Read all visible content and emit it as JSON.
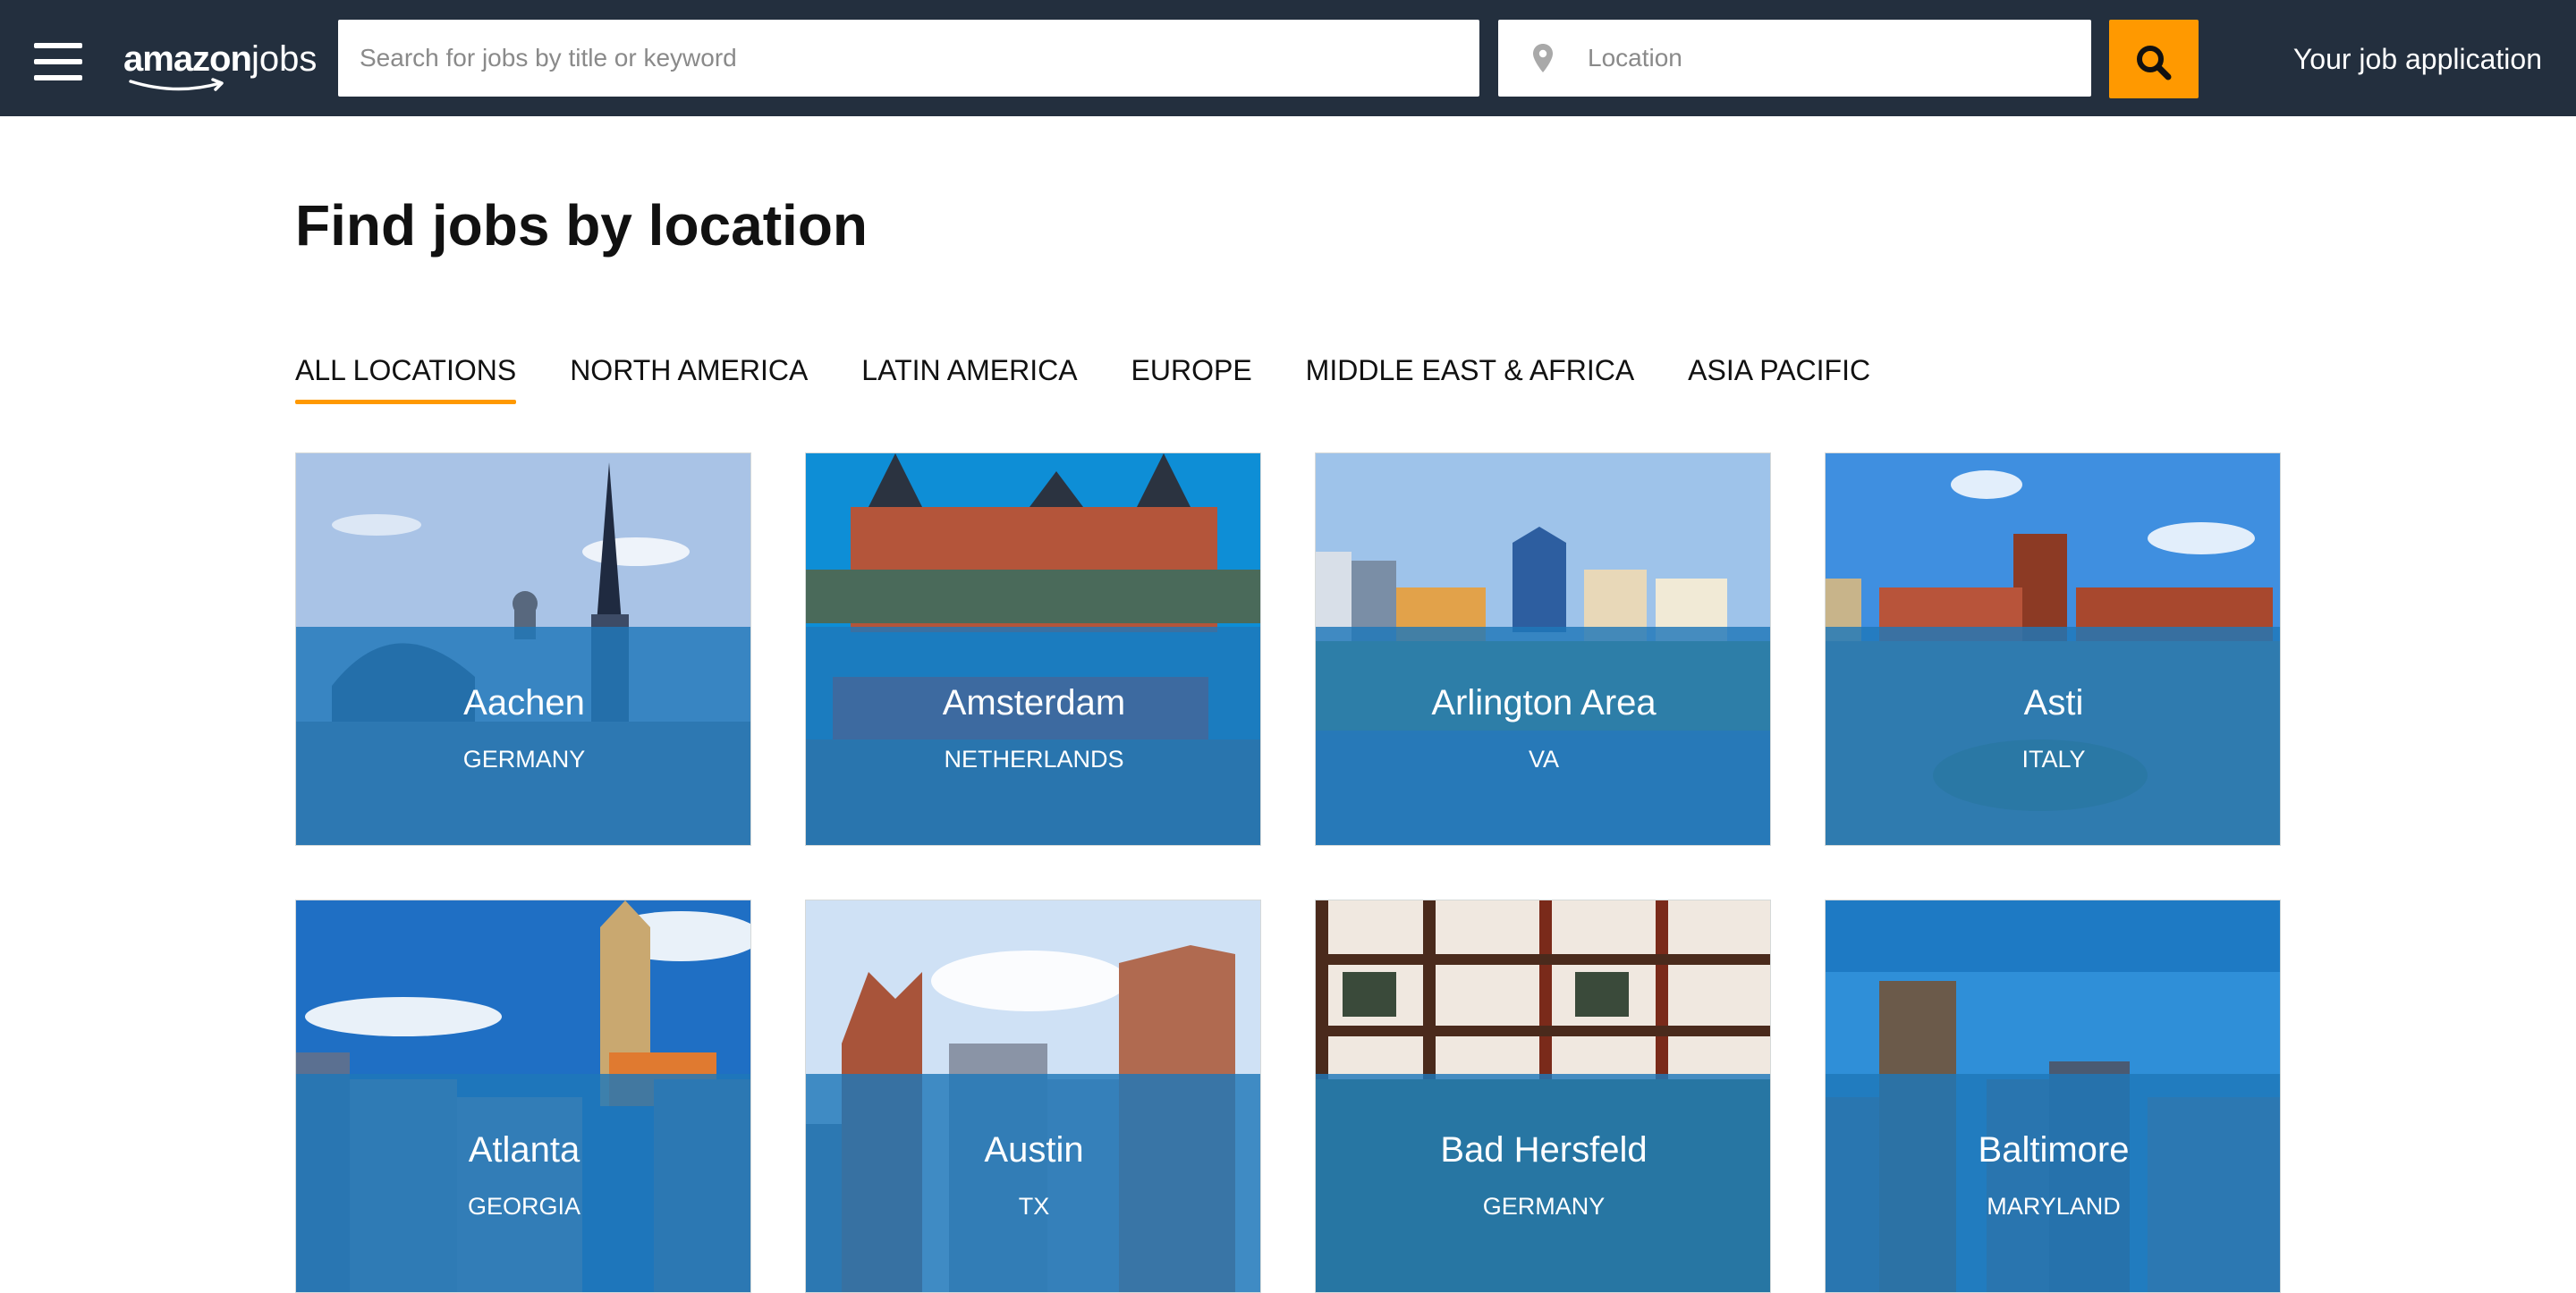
{
  "header": {
    "logo_amazon": "amazon",
    "logo_jobs": "jobs",
    "search_placeholder": "Search for jobs by title or keyword",
    "location_placeholder": "Location",
    "your_application": "Your job application"
  },
  "page": {
    "title": "Find jobs by location"
  },
  "tabs": [
    {
      "label": "ALL LOCATIONS",
      "active": true
    },
    {
      "label": "NORTH AMERICA",
      "active": false
    },
    {
      "label": "LATIN AMERICA",
      "active": false
    },
    {
      "label": "EUROPE",
      "active": false
    },
    {
      "label": "MIDDLE EAST & AFRICA",
      "active": false
    },
    {
      "label": "ASIA PACIFIC",
      "active": false
    }
  ],
  "locations": [
    {
      "city": "Aachen",
      "region": "GERMANY"
    },
    {
      "city": "Amsterdam",
      "region": "NETHERLANDS"
    },
    {
      "city": "Arlington Area",
      "region": "VA"
    },
    {
      "city": "Asti",
      "region": "ITALY"
    },
    {
      "city": "Atlanta",
      "region": "GEORGIA"
    },
    {
      "city": "Austin",
      "region": "TX"
    },
    {
      "city": "Bad Hersfeld",
      "region": "GERMANY"
    },
    {
      "city": "Baltimore",
      "region": "MARYLAND"
    }
  ],
  "colors": {
    "topbar": "#232f3e",
    "accent": "#ff9900",
    "card_overlay": "#1f78b9"
  }
}
